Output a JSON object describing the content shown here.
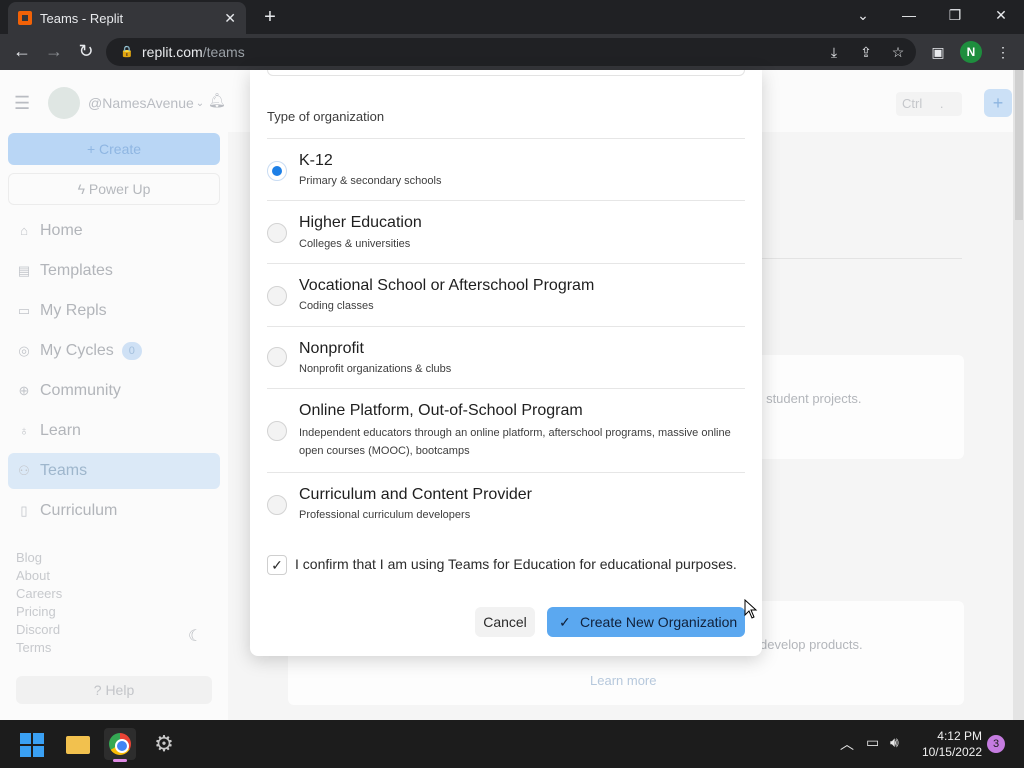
{
  "browser": {
    "tab_title": "Teams - Replit",
    "tab_close": "✕",
    "new_tab": "+",
    "url_host": "replit.com",
    "url_path": "/teams",
    "profile_initial": "N",
    "window_controls": {
      "tab_search": "⌄",
      "minimize": "—",
      "restore": "❐",
      "close": "✕"
    }
  },
  "sidebar": {
    "username": "@NamesAvenue",
    "create_label": "Create",
    "powerup_label": "Power Up",
    "nav_items": [
      {
        "label": "Home",
        "icon": "home-icon"
      },
      {
        "label": "Templates",
        "icon": "templates-icon"
      },
      {
        "label": "My Repls",
        "icon": "folder-icon"
      },
      {
        "label": "My Cycles",
        "icon": "cycles-icon",
        "badge": "0"
      },
      {
        "label": "Community",
        "icon": "globe-icon"
      },
      {
        "label": "Learn",
        "icon": "learn-icon"
      },
      {
        "label": "Teams",
        "icon": "teams-icon",
        "active": true
      },
      {
        "label": "Curriculum",
        "icon": "book-icon"
      }
    ],
    "footer_links": [
      "Blog",
      "About",
      "Careers",
      "Pricing",
      "Discord",
      "Terms"
    ],
    "help_label": "Help"
  },
  "header": {
    "shortcut_text": "Ctrl",
    "shortcut_key": "."
  },
  "background_cards": {
    "card1_text": "ge student projects.",
    "card2_text": "develop products.",
    "learn_more": "Learn more"
  },
  "modal": {
    "section_label": "Type of organization",
    "options": [
      {
        "title": "K-12",
        "description": "Primary & secondary schools",
        "selected": true
      },
      {
        "title": "Higher Education",
        "description": "Colleges & universities",
        "selected": false
      },
      {
        "title": "Vocational School or Afterschool Program",
        "description": "Coding classes",
        "selected": false
      },
      {
        "title": "Nonprofit",
        "description": "Nonprofit organizations & clubs",
        "selected": false
      },
      {
        "title": "Online Platform, Out-of-School Program",
        "description": "Independent educators through an online platform, afterschool programs, massive online open courses (MOOC), bootcamps",
        "selected": false
      },
      {
        "title": "Curriculum and Content Provider",
        "description": "Professional curriculum developers",
        "selected": false
      }
    ],
    "confirm_text": "I confirm that I am using Teams for Education for educational purposes.",
    "confirm_checked": true,
    "cancel_label": "Cancel",
    "create_label": "Create New Organization"
  },
  "taskbar": {
    "time": "4:12 PM",
    "date": "10/15/2022",
    "notification_count": "3"
  },
  "colors": {
    "accent": "#1d7fe6",
    "primary_button": "#5ba8f0"
  }
}
